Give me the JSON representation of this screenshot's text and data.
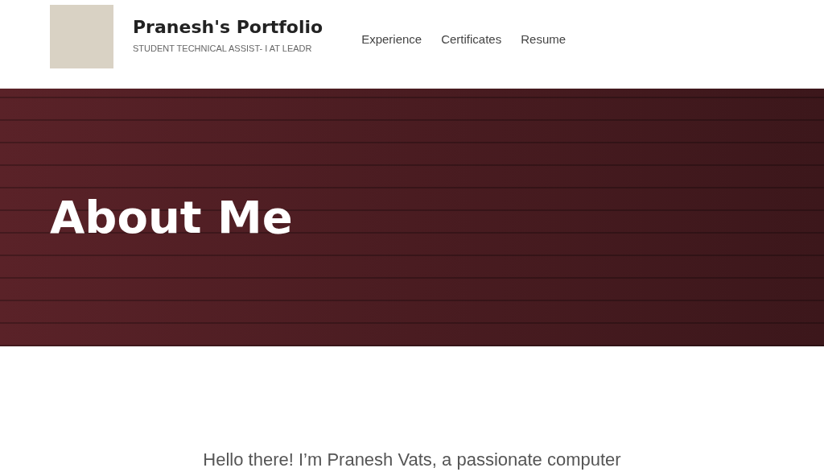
{
  "header": {
    "title": "Pranesh's Portfolio",
    "subtitle": "STUDENT TECHNICAL ASSIST- I AT LEADR",
    "nav": [
      {
        "label": "Experience"
      },
      {
        "label": "Certificates"
      },
      {
        "label": "Resume"
      }
    ]
  },
  "hero": {
    "title": "About Me"
  },
  "intro": {
    "text": "Hello there! I’m Pranesh Vats, a passionate computer"
  }
}
